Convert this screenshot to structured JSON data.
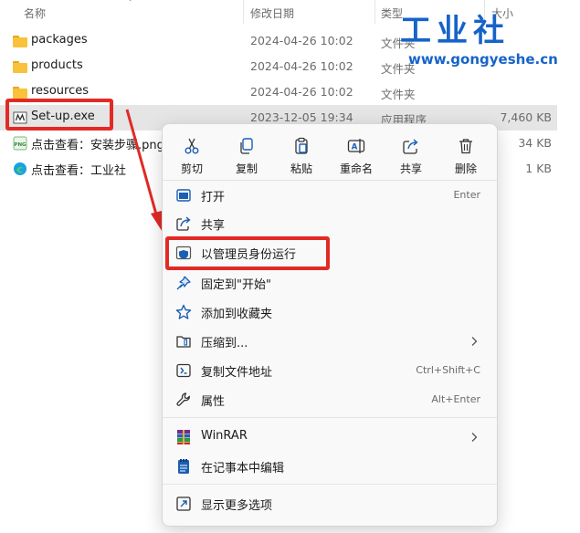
{
  "header": {
    "name_label": "名称",
    "date_label": "修改日期",
    "type_label": "类型",
    "size_label": "大小"
  },
  "files": [
    {
      "name": "packages",
      "date": "2024-04-26 10:02",
      "type": "文件夹",
      "size": ""
    },
    {
      "name": "products",
      "date": "2024-04-26 10:02",
      "type": "文件夹",
      "size": ""
    },
    {
      "name": "resources",
      "date": "2024-04-26 10:02",
      "type": "文件夹",
      "size": ""
    },
    {
      "name": "Set-up.exe",
      "date": "2023-12-05 19:34",
      "type": "应用程序",
      "size": "7,460 KB"
    },
    {
      "name": "点击查看：安装步骤.png",
      "size": "34 KB"
    },
    {
      "name": "点击查看：工业社",
      "size": "1 KB"
    }
  ],
  "watermark": {
    "title": "工业社",
    "url": "www.gongyeshe.cn"
  },
  "context_menu": {
    "quick_actions": [
      {
        "label": "剪切",
        "icon": "scissors-icon"
      },
      {
        "label": "复制",
        "icon": "copy-icon"
      },
      {
        "label": "粘贴",
        "icon": "paste-icon"
      },
      {
        "label": "重命名",
        "icon": "rename-icon"
      },
      {
        "label": "共享",
        "icon": "share-icon"
      },
      {
        "label": "删除",
        "icon": "trash-icon"
      }
    ],
    "items": [
      {
        "label": "打开",
        "shortcut": "Enter",
        "icon": "open-window-icon"
      },
      {
        "label": "共享",
        "shortcut": "",
        "icon": "share-icon"
      },
      {
        "label": "以管理员身份运行",
        "shortcut": "",
        "icon": "admin-shield-icon"
      },
      {
        "label": "固定到\"开始\"",
        "shortcut": "",
        "icon": "pin-icon"
      },
      {
        "label": "添加到收藏夹",
        "shortcut": "",
        "icon": "star-icon"
      },
      {
        "label": "压缩到...",
        "shortcut": "",
        "icon": "zip-folder-icon",
        "has_submenu": true
      },
      {
        "label": "复制文件地址",
        "shortcut": "Ctrl+Shift+C",
        "icon": "copy-path-icon"
      },
      {
        "label": "属性",
        "shortcut": "Alt+Enter",
        "icon": "wrench-icon"
      },
      {
        "label": "WinRAR",
        "shortcut": "",
        "icon": "winrar-icon",
        "has_submenu": true
      },
      {
        "label": "在记事本中编辑",
        "shortcut": "",
        "icon": "notepad-icon"
      },
      {
        "label": "显示更多选项",
        "shortcut": "",
        "icon": "more-options-icon"
      }
    ]
  },
  "colors": {
    "highlight_red": "#e22a25",
    "accent_blue": "#1663c9",
    "folder_yellow": "#f8c33a",
    "selected_row": "#e5e5e5"
  }
}
